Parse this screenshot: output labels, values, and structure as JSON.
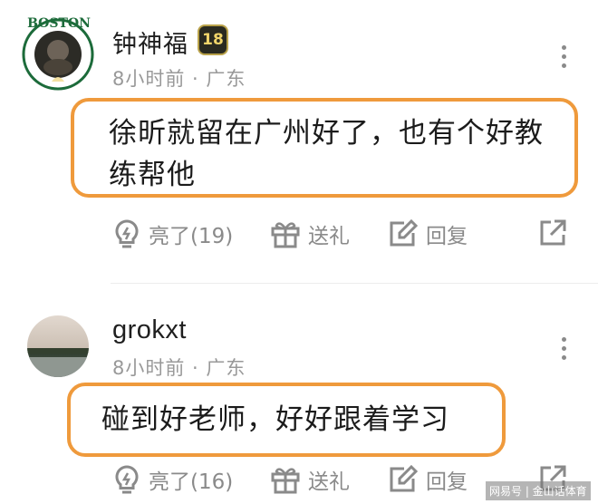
{
  "colors": {
    "bubble_border": "#ef9a3c",
    "meta_text": "#999999",
    "action_text": "#8a8a8a"
  },
  "comments": [
    {
      "username": "钟神福",
      "badge": "18",
      "avatar_logo_text": "BOSTON",
      "meta": "8小时前 · 广东",
      "text_line1": "徐昕就留在广州好了，也有个好教",
      "text_line2": "练帮他",
      "actions": {
        "like_icon": "lightbulb-icon",
        "like": "亮了(19)",
        "gift_icon": "gift-icon",
        "gift": "送礼",
        "reply_icon": "edit-icon",
        "reply": "回复",
        "share_icon": "share-icon"
      }
    },
    {
      "username": "grokxt",
      "meta": "8小时前 · 广东",
      "text_line1": "碰到好老师，好好跟着学习",
      "actions": {
        "like_icon": "lightbulb-icon",
        "like": "亮了(16)",
        "gift_icon": "gift-icon",
        "gift": "送礼",
        "reply_icon": "edit-icon",
        "reply": "回复",
        "share_icon": "share-icon"
      }
    }
  ],
  "watermark": "网易号 | 金山话体育"
}
